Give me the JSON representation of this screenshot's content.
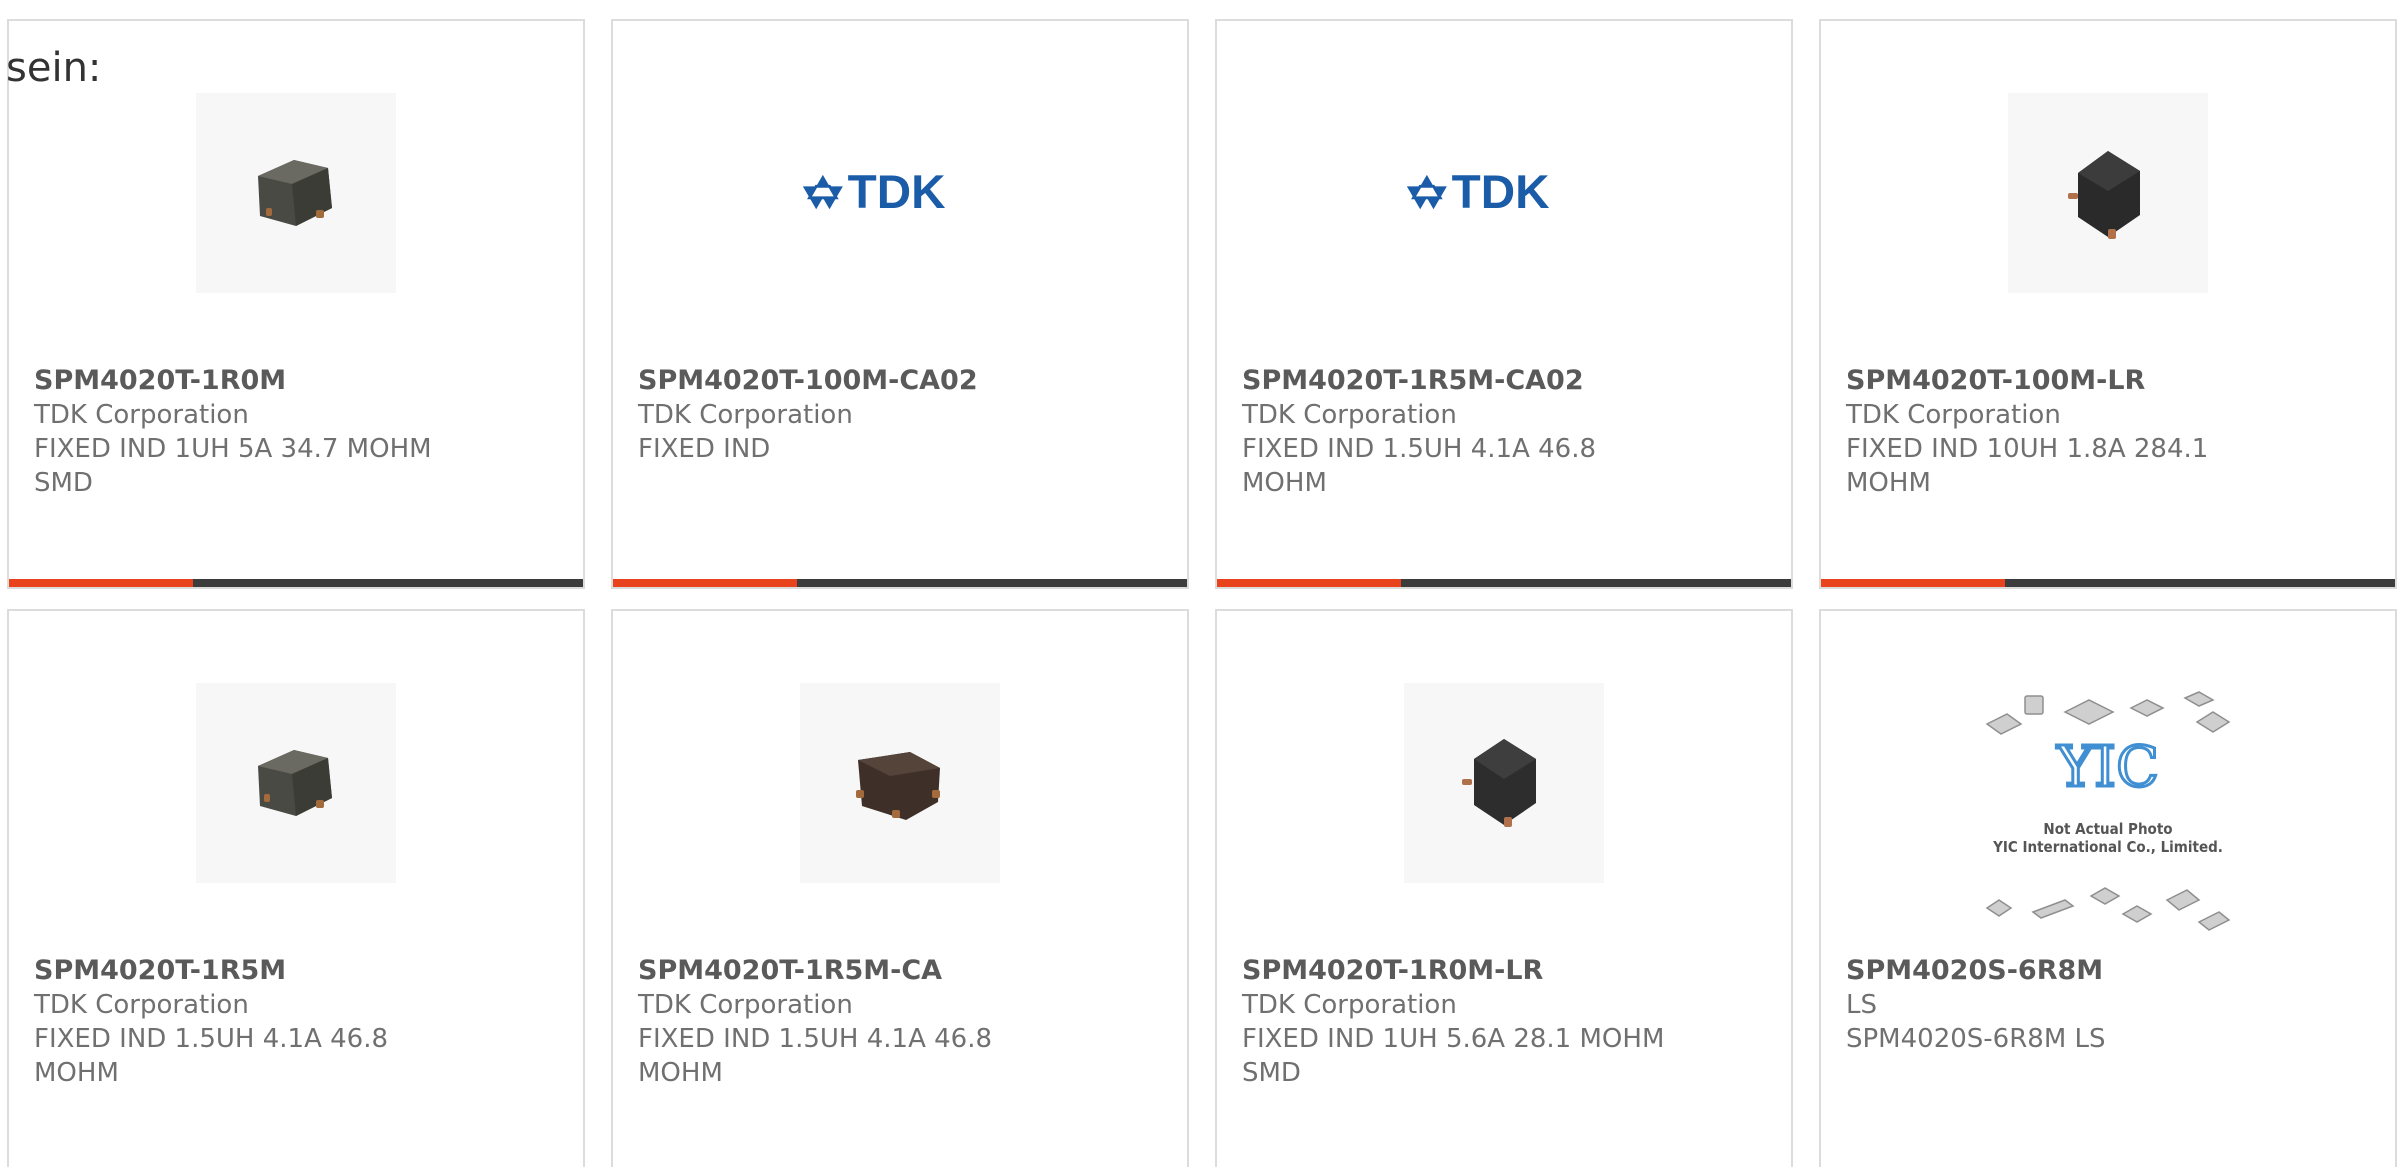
{
  "prefix_text": "sein:",
  "colors": {
    "accent": "#e8431c",
    "bar_dark": "#3c3c3c",
    "tdk_blue": "#1b5ca8",
    "border": "#dcdcdc"
  },
  "cards": [
    {
      "part": "SPM4020T-1R0M",
      "manufacturer": "TDK Corporation",
      "description": "FIXED IND 1UH 5A 34.7 MOHM SMD",
      "image": "inductor-photo-icon",
      "bar_progress": 0.32
    },
    {
      "part": "SPM4020T-100M-CA02",
      "manufacturer": "TDK Corporation",
      "description": "FIXED IND",
      "image": "tdk-logo",
      "logo_text": "TDK",
      "bar_progress": 0.32
    },
    {
      "part": "SPM4020T-1R5M-CA02",
      "manufacturer": "TDK Corporation",
      "description": "FIXED IND 1.5UH 4.1A 46.8 MOHM",
      "image": "tdk-logo",
      "logo_text": "TDK",
      "bar_progress": 0.32
    },
    {
      "part": "SPM4020T-100M-LR",
      "manufacturer": "TDK Corporation",
      "description": "FIXED IND 10UH 1.8A 284.1 MOHM",
      "image": "inductor-photo-icon",
      "bar_progress": 0.32
    },
    {
      "part": "SPM4020T-1R5M",
      "manufacturer": "TDK Corporation",
      "description": "FIXED IND 1.5UH 4.1A 46.8 MOHM",
      "image": "inductor-photo-icon"
    },
    {
      "part": "SPM4020T-1R5M-CA",
      "manufacturer": "TDK Corporation",
      "description": "FIXED IND 1.5UH 4.1A 46.8 MOHM",
      "image": "inductor-photo-icon"
    },
    {
      "part": "SPM4020T-1R0M-LR",
      "manufacturer": "TDK Corporation",
      "description": "FIXED IND 1UH 5.6A 28.1 MOHM SMD",
      "image": "inductor-photo-icon"
    },
    {
      "part": "SPM4020S-6R8M",
      "manufacturer": "LS",
      "description": "SPM4020S-6R8M LS",
      "image": "placeholder-photo-icon",
      "placeholder_caption_1": "Not Actual Photo",
      "placeholder_caption_2": "YIC International Co., Limited.",
      "placeholder_logo_text": "YIC"
    }
  ]
}
